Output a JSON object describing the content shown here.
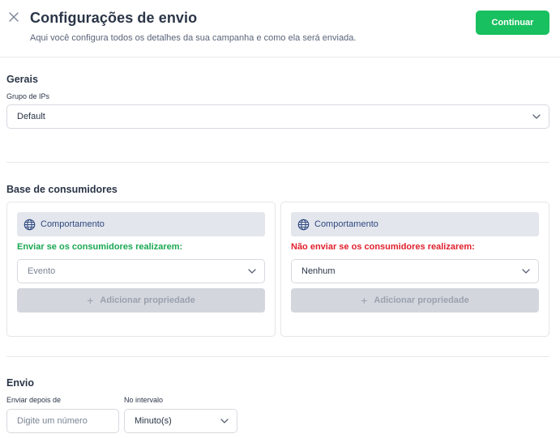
{
  "header": {
    "title": "Configurações de envio",
    "subtitle": "Aqui você configura todos os detalhes da sua campanha e como ela será enviada.",
    "continue_label": "Continuar"
  },
  "gerais": {
    "section_title": "Gerais",
    "ip_group_label": "Grupo de IPs",
    "ip_group_value": "Default"
  },
  "base": {
    "section_title": "Base de consumidores",
    "include": {
      "behavior_label": "Comportamento",
      "condition_label": "Enviar se os consumidores realizarem:",
      "select_value": "Evento",
      "add_property_label": "Adicionar propriedade"
    },
    "exclude": {
      "behavior_label": "Comportamento",
      "condition_label": "Não enviar se os consumidores realizarem:",
      "select_value": "Nenhum",
      "add_property_label": "Adicionar propriedade"
    }
  },
  "envio": {
    "section_title": "Envio",
    "send_after_label": "Enviar depois de",
    "send_after_placeholder": "Digite um número",
    "interval_label": "No intervalo",
    "interval_value": "Minuto(s)"
  },
  "colors": {
    "primary_green": "#19c05f",
    "include_text": "#1aa853",
    "exclude_text": "#e0202d",
    "behavior_icon": "#2f4880"
  },
  "icons": {
    "close": "close-icon",
    "behavior": "globe-icon",
    "chevron": "chevron-down-icon",
    "add": "plus-icon"
  }
}
